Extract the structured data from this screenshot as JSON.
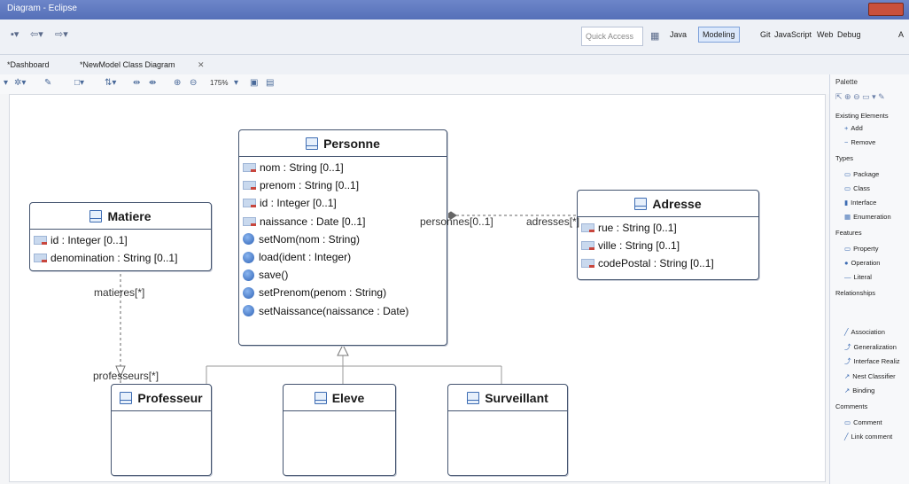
{
  "window": {
    "title": "Diagram - Eclipse"
  },
  "toolbar": {
    "quick_access": "Quick Access",
    "perspectives": [
      "Java",
      "Modeling",
      "Git",
      "JavaScript",
      "Web",
      "Debug",
      "A"
    ],
    "active_perspective": "Modeling"
  },
  "tabs": [
    {
      "label": "*Dashboard",
      "active": false
    },
    {
      "label": "*NewModel Class Diagram",
      "active": true
    }
  ],
  "diagram_toolbar": {
    "zoom": "175%"
  },
  "classes": {
    "personne": {
      "name": "Personne",
      "attributes": [
        "nom : String [0..1]",
        "prenom : String [0..1]",
        "id : Integer [0..1]",
        "naissance : Date [0..1]"
      ],
      "operations": [
        "setNom(nom : String)",
        "load(ident : Integer)",
        "save()",
        "setPrenom(penom : String)",
        "setNaissance(naissance : Date)"
      ]
    },
    "matiere": {
      "name": "Matiere",
      "attributes": [
        "id : Integer [0..1]",
        "denomination : String [0..1]"
      ]
    },
    "adresse": {
      "name": "Adresse",
      "attributes": [
        "rue : String [0..1]",
        "ville : String [0..1]",
        "codePostal : String [0..1]"
      ]
    },
    "professeur": {
      "name": "Professeur"
    },
    "eleve": {
      "name": "Eleve"
    },
    "surveillant": {
      "name": "Surveillant"
    }
  },
  "links": {
    "personnes": "personnes[0..1]",
    "adresses": "adresses[*]",
    "matieres": "matieres[*]",
    "professeurs": "professeurs[*]"
  },
  "palette": {
    "title": "Palette",
    "sections": [
      {
        "label": "Existing Elements",
        "items": [
          "Add",
          "Remove"
        ]
      },
      {
        "label": "Types",
        "items": [
          "Package",
          "Class",
          "Interface",
          "Enumeration"
        ]
      },
      {
        "label": "Features",
        "items": [
          "Property",
          "Operation",
          "Literal"
        ]
      },
      {
        "label": "Relationships",
        "items": [
          "Association",
          "Generalization",
          "Interface Realiz",
          "Nest Classifier",
          "Binding"
        ]
      },
      {
        "label": "Comments",
        "items": [
          "Comment",
          "Link comment"
        ]
      }
    ]
  },
  "colors": {
    "accent": "#3d6cb3",
    "title_bar": "#5570b8",
    "border": "#44546f"
  }
}
